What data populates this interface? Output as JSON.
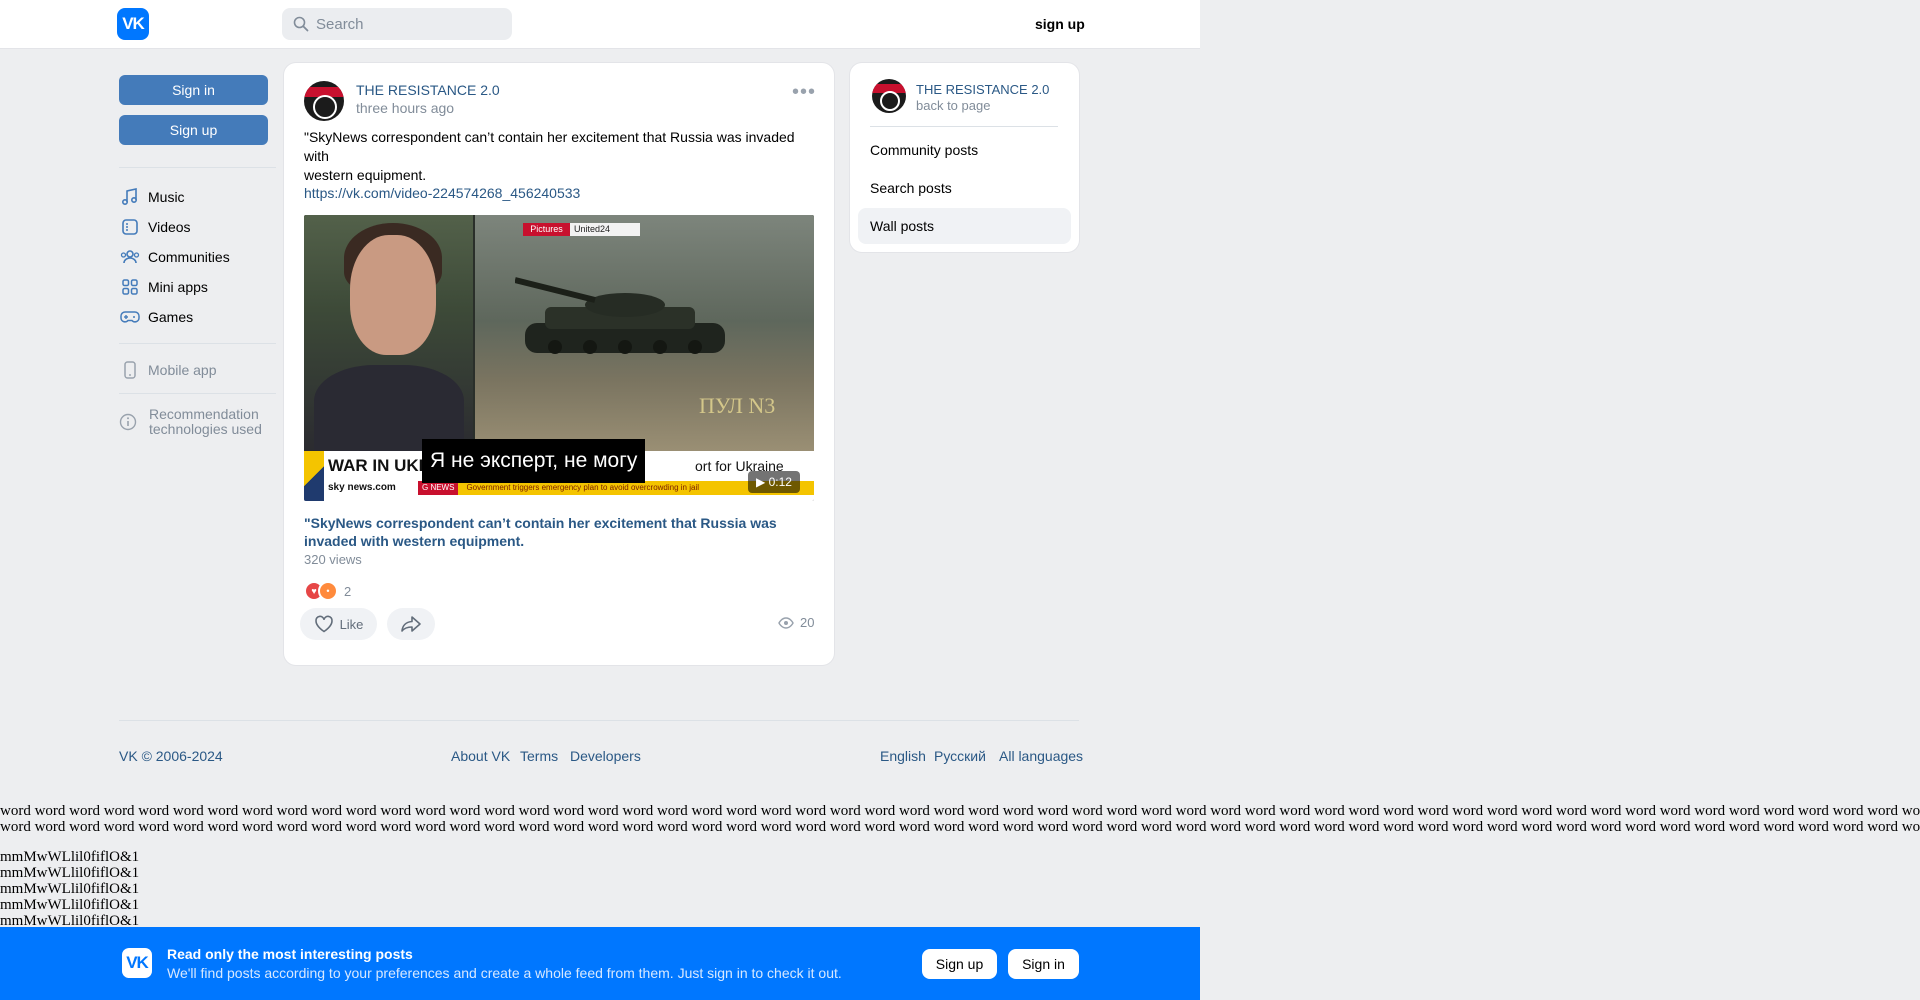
{
  "header": {
    "logo_text": "VK",
    "search_placeholder": "Search",
    "signup_link": "sign up"
  },
  "left_sidebar": {
    "sign_in": "Sign in",
    "sign_up": "Sign up",
    "nav": [
      {
        "label": "Music",
        "icon": "music-icon"
      },
      {
        "label": "Videos",
        "icon": "video-icon"
      },
      {
        "label": "Communities",
        "icon": "communities-icon"
      },
      {
        "label": "Mini apps",
        "icon": "mini-apps-icon"
      },
      {
        "label": "Games",
        "icon": "gamepad-icon"
      }
    ],
    "mobile_app": "Mobile app",
    "recommendation_line1": "Recommendation",
    "recommendation_line2": "technologies used"
  },
  "post": {
    "author": "THE RESISTANCE 2.0",
    "time": "three hours ago",
    "text_line1": "\"SkyNews correspondent can’t contain her excitement that Russia was invaded with",
    "text_line2": "western equipment.",
    "link": "https://vk.com/video-224574268_456240533",
    "video": {
      "tag_pictures": "Pictures",
      "tag_united": "United24",
      "right_caption": "ПУЛ N3",
      "lower_title": "WAR IN UKRA",
      "lower_support": "ort for Ukraine",
      "brand": "sky news.com",
      "ticker_tag": "G NEWS",
      "ticker_text": "Government triggers emergency plan to avoid overcrowding in jail",
      "subtitle": "Я не эксперт, не могу",
      "duration": "0:12"
    },
    "attachment_title": "\"SkyNews correspondent can’t contain her excitement that Russia was invaded with western equipment.",
    "attachment_views": "320 views",
    "reaction_count": "2",
    "like_label": "Like",
    "views_count": "20"
  },
  "right_sidebar": {
    "title": "THE RESISTANCE 2.0",
    "subtitle": "back to page",
    "items": [
      "Community posts",
      "Search posts",
      "Wall posts"
    ],
    "active_item": "Wall posts"
  },
  "footer": {
    "copyright": "VK © 2006-2024",
    "links": [
      "About VK",
      "Terms",
      "Developers"
    ],
    "languages": [
      "English",
      "Русский",
      "All languages"
    ]
  },
  "filler": {
    "words_line1": "word word word word word word word word word word word word word word word word word word word word word word word word word word word word word word word word word word word word word word word word word word word word word word word word word word word word word word word word word",
    "words_line2": "word word word word word word word word word word word word word word word word word word word word word word word word word word word word word word word word word word word word word word word word word word word word word word word word word word word word word word word word word",
    "chars_lines": [
      "mmMwWLlil0fiflO&1",
      "mmMwWLlil0fiflO&1",
      "mmMwWLlil0fiflO&1",
      "mmMwWLlil0fiflO&1",
      "mmMwWLlil0fiflO&1"
    ]
  },
  "banner": {
    "title": "Read only the most interesting posts",
    "subtitle": "We'll find posts according to your preferences and create a whole feed from them. Just sign in to check it out.",
    "sign_up": "Sign up",
    "sign_in": "Sign in"
  }
}
